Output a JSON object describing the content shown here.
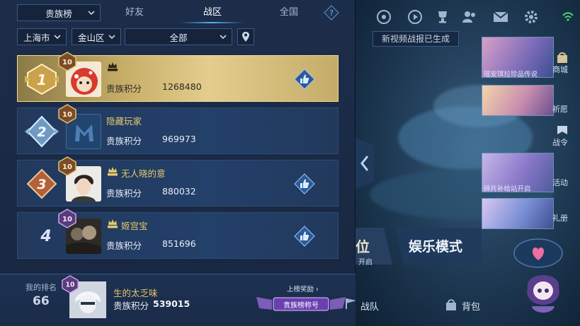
{
  "header": {
    "category_select": "贵族榜",
    "tabs": [
      {
        "label": "好友",
        "active": false
      },
      {
        "label": "战区",
        "active": true
      },
      {
        "label": "全国",
        "active": false
      }
    ],
    "help_icon": "question-icon"
  },
  "filters": {
    "city": "上海市",
    "district": "金山区",
    "scope": "全部"
  },
  "rows": [
    {
      "rank": "1",
      "level": "10",
      "name": "",
      "score_label": "贵族积分",
      "score": "1268480",
      "vip": "SVIP"
    },
    {
      "rank": "2",
      "level": "10",
      "name": "隐藏玩家",
      "score_label": "贵族积分",
      "score": "969973",
      "vip": ""
    },
    {
      "rank": "3",
      "level": "10",
      "name": "无人晓的意",
      "score_label": "贵族积分",
      "score": "880032",
      "vip": "SVIP"
    },
    {
      "rank": "4",
      "level": "10",
      "name": "姬宫宝",
      "score_label": "贵族积分",
      "score": "851696",
      "vip": "SVIP"
    }
  ],
  "my_rank": {
    "label": "我的排名",
    "rank": "66",
    "level": "10",
    "name": "生的太乏味",
    "score_label": "贵族积分",
    "score": "539015",
    "reward_link": "上榜奖励",
    "reward_badge": "贵族榜称号"
  },
  "game": {
    "banner": "新视频战报已生成",
    "card_labels": [
      "瑶安琪拉珍品传说",
      "碎片补给站开启"
    ],
    "side_labels": [
      "商城",
      "祈愿",
      "战令",
      "活动",
      "礼册"
    ],
    "mode_left": "位",
    "mode_left_sub": "开启",
    "mode_label": "娱乐模式",
    "bottom_labels": [
      "战队",
      "背包"
    ]
  },
  "colors": {
    "panel_bg": "#1c2d4a",
    "gold_row": "#e4cd8e",
    "accent_blue": "#52b6ff",
    "name_gold": "#e6c86a"
  }
}
